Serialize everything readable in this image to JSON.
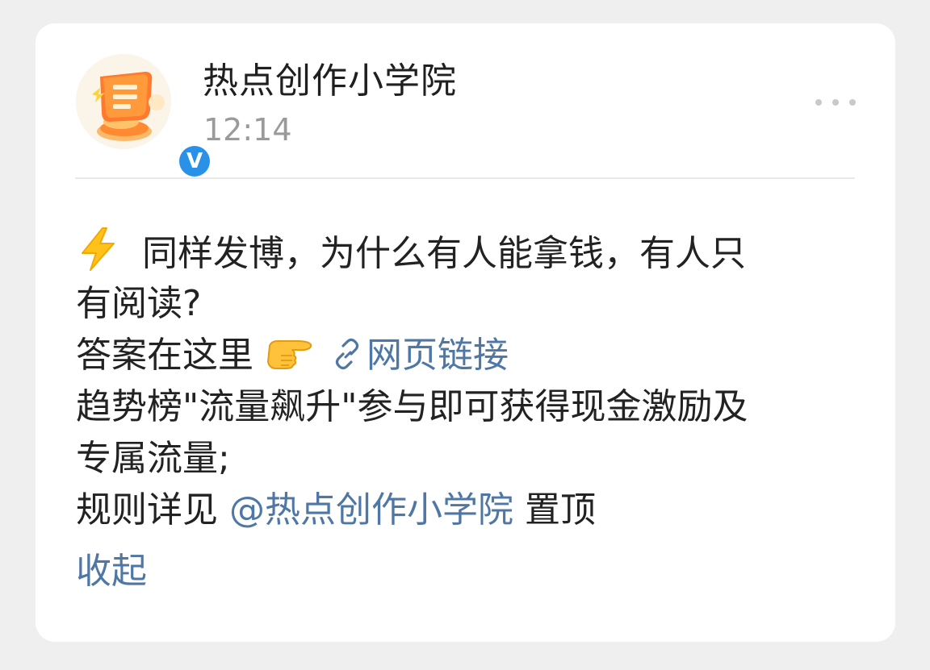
{
  "post": {
    "account_name": "热点创作小学院",
    "time": "12:14",
    "verified_badge": "V",
    "more_icon": "more-dots-icon",
    "avatar_icon": "scroll-coin-avatar",
    "colors": {
      "background": "#efefef",
      "card": "#ffffff",
      "text": "#222222",
      "link": "#4f77a6",
      "time": "#9a9a9a",
      "verified": "#2a91e8"
    },
    "body": {
      "line1_icon": "lightning-bolt-icon",
      "line1_text": "同样发博，为什么有人能拿钱，有人只",
      "line2_text": "有阅读?",
      "line3_text": "答案在这里",
      "line3_icon": "pointing-right-hand-icon",
      "web_link_icon": "link-icon",
      "web_link_label": "网页链接",
      "line4_text": "趋势榜\"流量飙升\"参与即可获得现金激励及",
      "line5_text": "专属流量;",
      "line6_prefix": "规则详见 ",
      "mention": "@热点创作小学院",
      "line6_suffix": " 置顶",
      "collapse_label": "收起"
    }
  }
}
